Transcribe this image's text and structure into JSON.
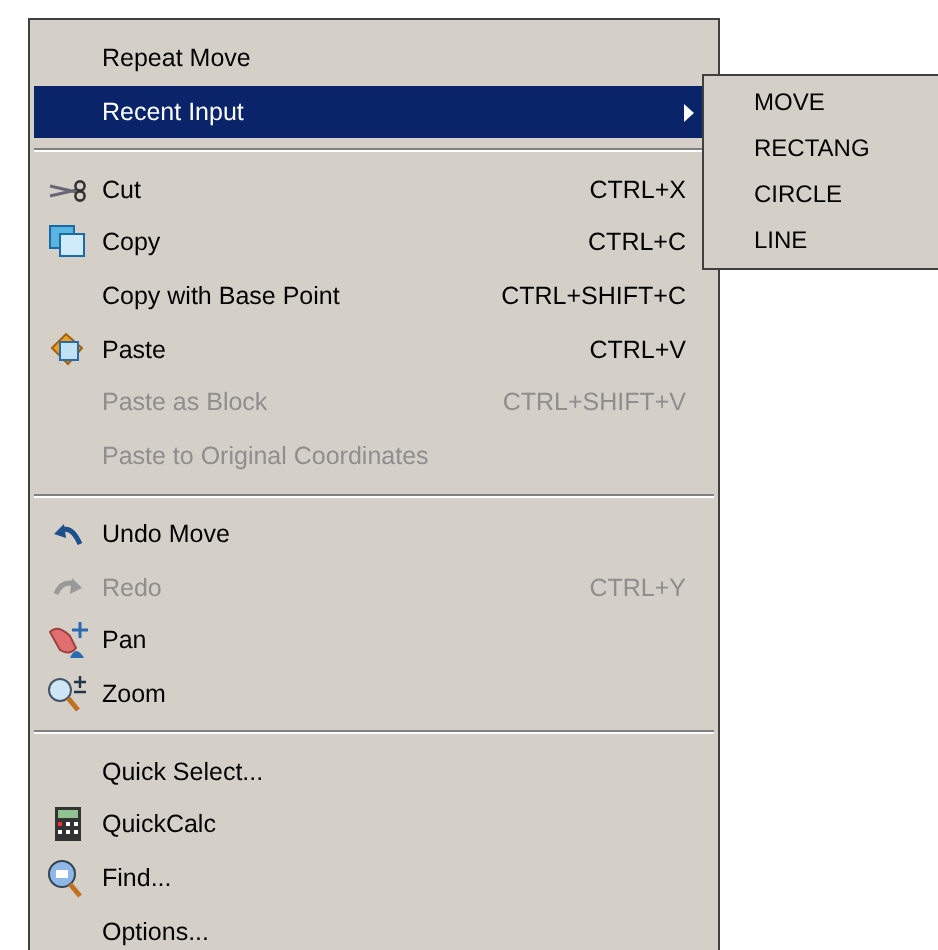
{
  "menu": {
    "items": [
      {
        "kind": "item",
        "label": "Repeat Move",
        "disabled": false,
        "selected": false
      },
      {
        "kind": "item",
        "label": "Recent Input",
        "disabled": false,
        "selected": true,
        "submenu": true
      },
      {
        "kind": "separator"
      },
      {
        "kind": "item",
        "label": "Cut",
        "shortcut": "CTRL+X",
        "disabled": false,
        "selected": false
      },
      {
        "kind": "item",
        "label": "Copy",
        "shortcut": "CTRL+C",
        "disabled": false,
        "selected": false
      },
      {
        "kind": "item",
        "label": "Copy with Base Point",
        "shortcut": "CTRL+SHIFT+C",
        "disabled": false,
        "selected": false
      },
      {
        "kind": "item",
        "label": "Paste",
        "shortcut": "CTRL+V",
        "disabled": false,
        "selected": false
      },
      {
        "kind": "item",
        "label": "Paste as Block",
        "shortcut": "CTRL+SHIFT+V",
        "disabled": true,
        "selected": false
      },
      {
        "kind": "item",
        "label": "Paste to Original Coordinates",
        "disabled": true,
        "selected": false
      },
      {
        "kind": "separator"
      },
      {
        "kind": "item",
        "label": "Undo Move",
        "disabled": false,
        "selected": false
      },
      {
        "kind": "item",
        "label": "Redo",
        "shortcut": "CTRL+Y",
        "disabled": true,
        "selected": false
      },
      {
        "kind": "item",
        "label": "Pan",
        "disabled": false,
        "selected": false
      },
      {
        "kind": "item",
        "label": "Zoom",
        "disabled": false,
        "selected": false
      },
      {
        "kind": "separator"
      },
      {
        "kind": "item",
        "label": "Quick Select...",
        "disabled": false,
        "selected": false
      },
      {
        "kind": "item",
        "label": "QuickCalc",
        "disabled": false,
        "selected": false
      },
      {
        "kind": "item",
        "label": "Find...",
        "disabled": false,
        "selected": false
      },
      {
        "kind": "item",
        "label": "Options...",
        "disabled": false,
        "selected": false
      }
    ]
  },
  "submenu": {
    "items": [
      {
        "label": "MOVE"
      },
      {
        "label": "RECTANG"
      },
      {
        "label": "CIRCLE"
      },
      {
        "label": "LINE"
      }
    ]
  }
}
